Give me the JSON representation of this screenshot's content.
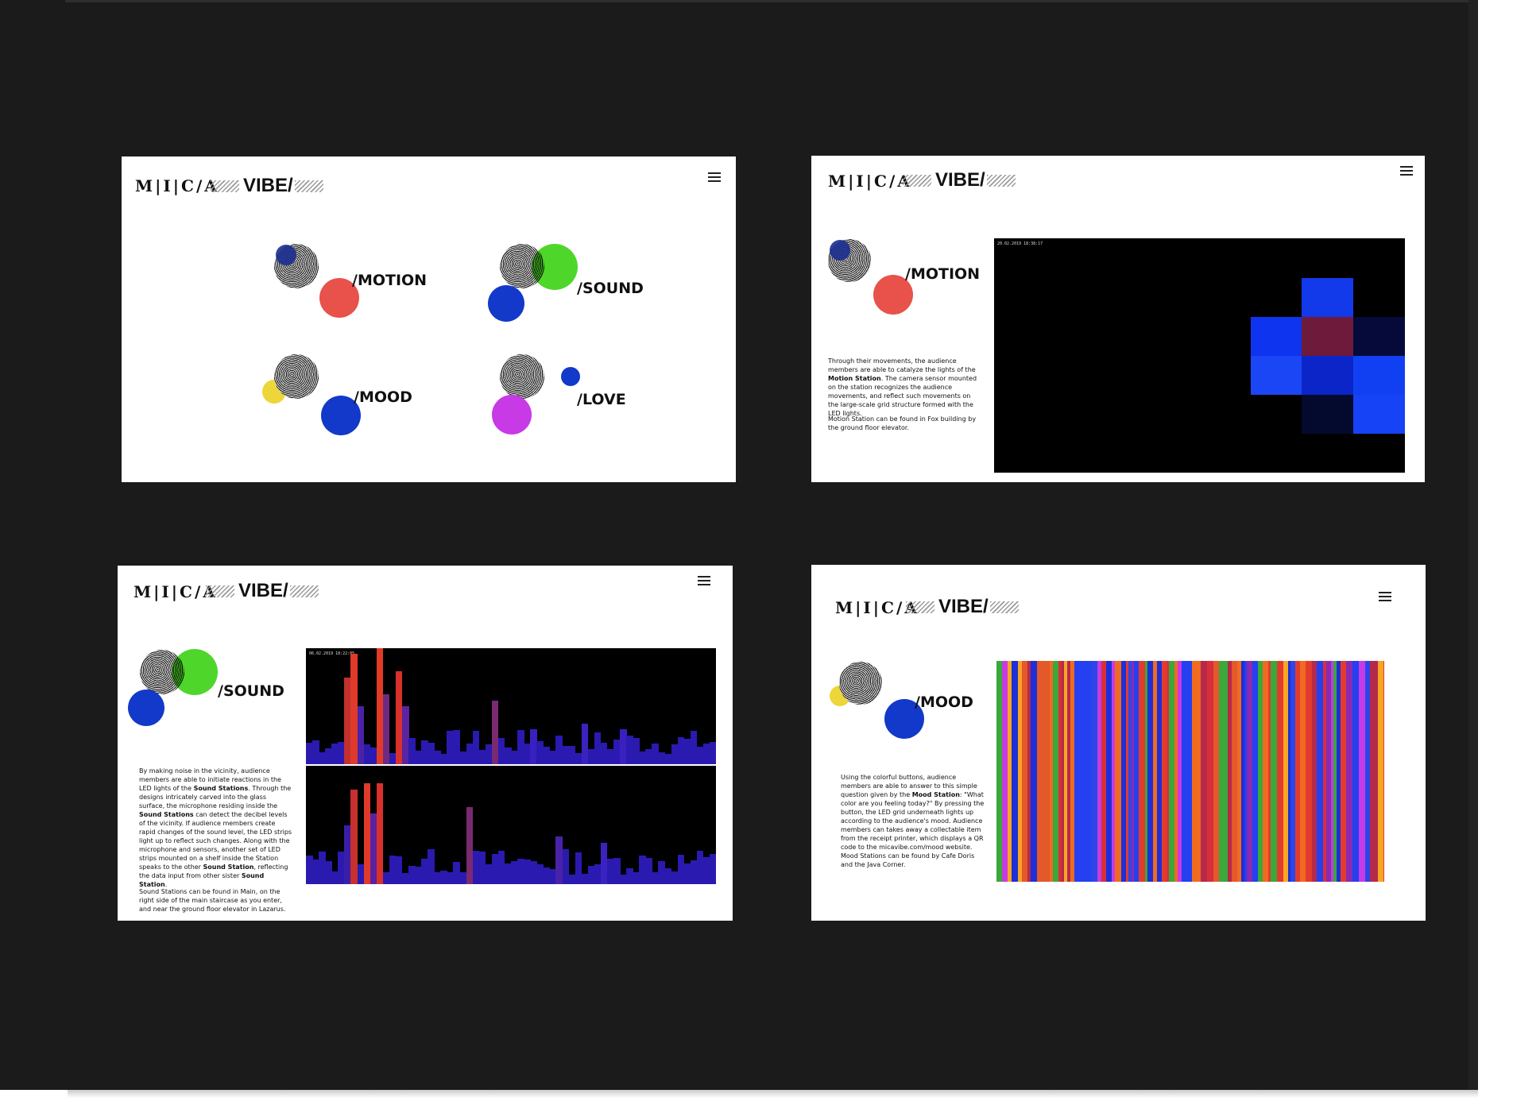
{
  "brand": {
    "mica": "M|I|C/A",
    "vibe": "VIBE/"
  },
  "home": {
    "stations": [
      {
        "label": "/MOTION"
      },
      {
        "label": "/SOUND"
      },
      {
        "label": "/MOOD"
      },
      {
        "label": "/LOVE"
      }
    ]
  },
  "motion": {
    "title": "/MOTION",
    "timestamp": "20.02.2019 18:38:17",
    "text1_parts": [
      "Through their movements, the audience members are able to catalyze the lights of the ",
      "Motion Station",
      ". The camera sensor mounted on the station recognizes the audience movements, and reflect such movements on the large-scale grid structure formed with the LED lights."
    ],
    "text2": "Motion Station can be found in Fox building by the ground floor elevator."
  },
  "sound": {
    "title": "/SOUND",
    "timestamp": "06.02.2019 18:22:05",
    "text1_parts": [
      "By making noise in the vicinity, audience members are able to initiate reactions in the LED lights of the ",
      "Sound Stations",
      ". Through the designs intricately carved into the glass surface, the microphone residing inside the ",
      "Sound Stations",
      " can detect the decibel levels of the vicinity. If audience members create rapid changes of the sound level, the LED strips light up to reflect such changes. Along with the microphone and sensors, another set of LED strips mounted on a shelf inside the Station speaks to the other ",
      "Sound Station",
      ", reflecting the data input from other sister ",
      "Sound Station",
      "."
    ],
    "text2": "Sound Stations can be found in Main, on the right side of the main staircase as you enter, and near the ground floor elevator in Lazarus."
  },
  "mood": {
    "title": "/MOOD",
    "text1_parts": [
      "Using the colorful buttons, audience members are able to answer to this simple question given by the ",
      "Mood Station",
      ": \"What color are you feeling today?\" By pressing the button, the LED grid underneath lights up according to the audience's mood. Audience members can takes away a collectable item from the receipt printer, which displays a QR code to the micavibe.com/mood website."
    ],
    "text2": "Mood Stations can be found by Cafe Doris and the Java Corner."
  },
  "icons": {
    "menu": "hamburger-menu-icon",
    "motion": "motion-station-icon",
    "sound": "sound-station-icon",
    "mood": "mood-station-icon",
    "love": "love-station-icon"
  },
  "colors": {
    "board": "#1b1b1b",
    "red": "#e8524a",
    "blue": "#1239c9",
    "green": "#4fd62a",
    "yellow": "#ecd63a",
    "magenta": "#c73ae6",
    "navy": "#0d2a8a"
  }
}
